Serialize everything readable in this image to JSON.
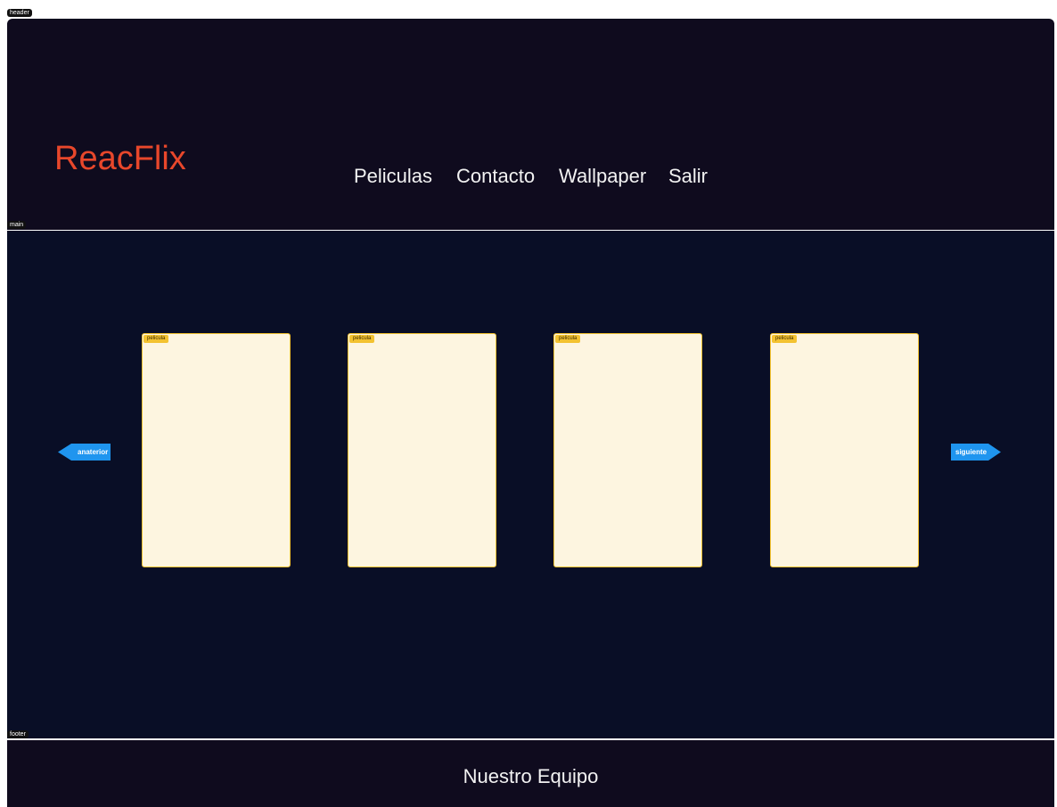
{
  "debug_tags": {
    "header": "header",
    "main": "main",
    "footer": "footer"
  },
  "header": {
    "logo": "ReacFlix",
    "nav": [
      {
        "label": "Peliculas"
      },
      {
        "label": "Contacto"
      },
      {
        "label": "Wallpaper"
      },
      {
        "label": "Salir"
      }
    ]
  },
  "main": {
    "prev_label": "anaterior",
    "next_label": "siguiente",
    "cards": [
      {
        "tag": "pelicula"
      },
      {
        "tag": "pelicula"
      },
      {
        "tag": "pelicula"
      },
      {
        "tag": "pelicula"
      }
    ]
  },
  "footer": {
    "title": "Nuestro Equipo"
  },
  "colors": {
    "header_bg": "#0f0b1e",
    "main_bg": "#090e26",
    "logo": "#e8472b",
    "card_bg": "#fdf5e0",
    "card_tag": "#f3c230",
    "button": "#1f95ef"
  }
}
